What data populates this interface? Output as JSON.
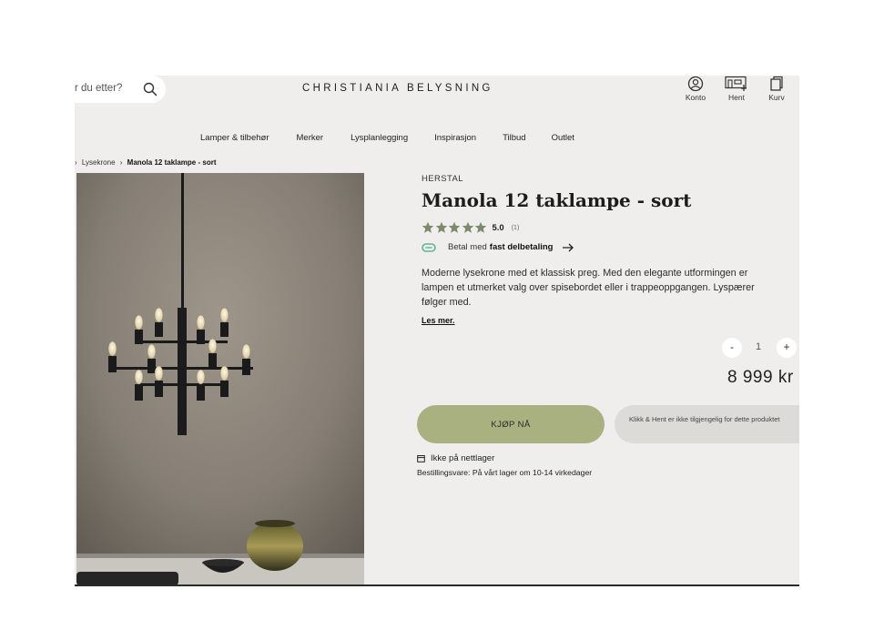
{
  "header": {
    "search_placeholder": "r du etter?",
    "logo": "CHRISTIANIA BELYSNING",
    "actions": [
      {
        "label": "Konto",
        "icon": "account-icon"
      },
      {
        "label": "Hent",
        "icon": "store-pickup-icon"
      },
      {
        "label": "Kurv",
        "icon": "cart-icon"
      }
    ]
  },
  "nav": {
    "items": [
      {
        "label": "Lamper & tilbehør"
      },
      {
        "label": "Merker"
      },
      {
        "label": "Lysplanlegging"
      },
      {
        "label": "Inspirasjon"
      },
      {
        "label": "Tilbud"
      },
      {
        "label": "Outlet"
      }
    ]
  },
  "breadcrumb": {
    "sep": "›",
    "category": "Lysekrone",
    "current": "Manola 12 taklampe - sort"
  },
  "product": {
    "brand": "HERSTAL",
    "title": "Manola 12 taklampe - sort",
    "rating": "5.0",
    "rating_value": 5,
    "review_count": "(1)",
    "payment_prefix": "Betal med",
    "payment_bold": "fast delbetaling",
    "description": "Moderne lysekrone med et klassisk preg. Med den elegante utformingen er lampen et utmerket valg over spisebordet eller i trappeoppgangen. Lyspærer følger med.",
    "read_more": "Les mer.",
    "quantity": {
      "minus": "-",
      "value": "1",
      "plus": "+"
    },
    "price": "8 999 kr",
    "buy_label": "KJØP NÅ",
    "pickup_notice": "Klikk & Hent er ikke tilgjengelig for dette produktet",
    "stock_status": "Ikke på nettlager",
    "delivery_info": "Bestillingsvare: På vårt lager om 10-14 virkedager"
  },
  "colors": {
    "page_bg": "#efeeec",
    "buy_button": "#aab180",
    "pickup_bg": "#dcdbd8",
    "star": "#7d8a69",
    "payment_icon": "#58b89a"
  }
}
